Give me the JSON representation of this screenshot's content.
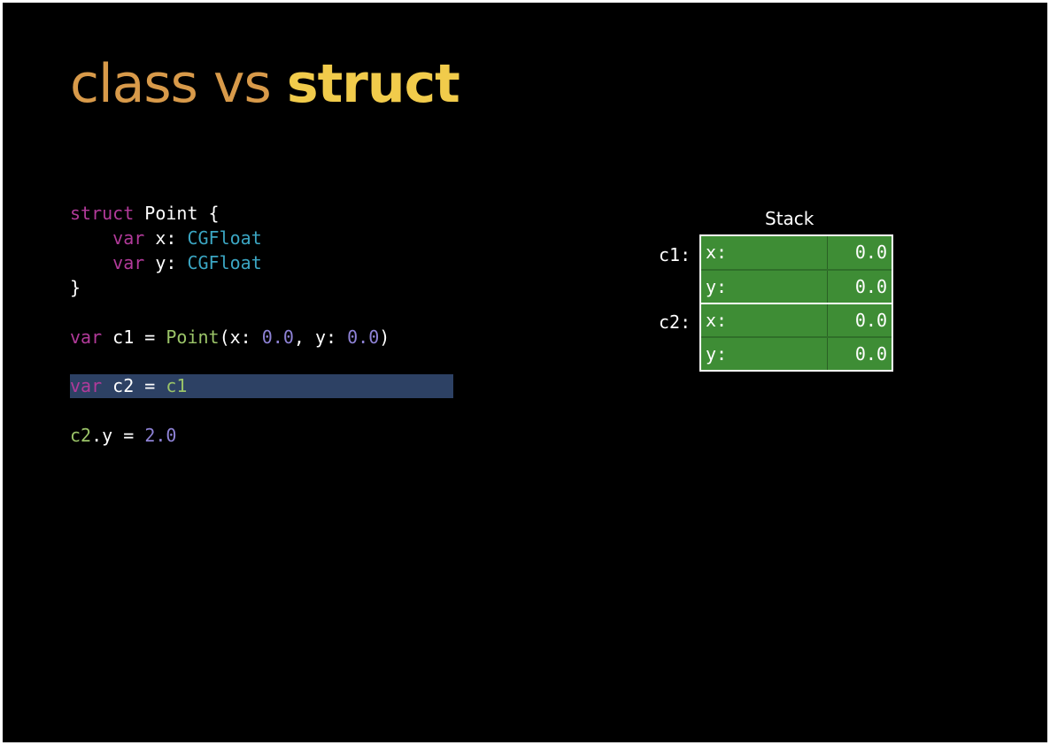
{
  "title": {
    "word1": "class",
    "word2": "vs",
    "word3": "struct"
  },
  "code": {
    "line1": {
      "kw": "struct",
      "rest": " Point {"
    },
    "line2": {
      "indent": "    ",
      "kw": "var",
      "name": " x: ",
      "type": "CGFloat"
    },
    "line3": {
      "indent": "    ",
      "kw": "var",
      "name": " y: ",
      "type": "CGFloat"
    },
    "line4": "}",
    "line5": {
      "kw": "var",
      "name": " c1 = ",
      "fn": "Point",
      "p1": "(x: ",
      "n1": "0.0",
      "p2": ", y: ",
      "n2": "0.0",
      "p3": ")"
    },
    "line6": {
      "kw": "var",
      "name": " c2 = ",
      "ref": "c1"
    },
    "line7": {
      "ref": "c2",
      "rest": ".y = ",
      "num": "2.0"
    }
  },
  "stack": {
    "title": "Stack",
    "vars": [
      {
        "label": "c1:",
        "fields": [
          {
            "name": "x:",
            "value": "0.0"
          },
          {
            "name": "y:",
            "value": "0.0"
          }
        ]
      },
      {
        "label": "c2:",
        "fields": [
          {
            "name": "x:",
            "value": "0.0"
          },
          {
            "name": "y:",
            "value": "0.0"
          }
        ]
      }
    ]
  },
  "colors": {
    "background": "#000000",
    "title_class": "#d89a4a",
    "title_struct": "#f1cb4b",
    "keyword": "#b23a9a",
    "type": "#3ba6c3",
    "number": "#8e82d6",
    "function": "#9bc468",
    "highlight": "#2d4164",
    "stack_cell": "#3e8d35"
  }
}
